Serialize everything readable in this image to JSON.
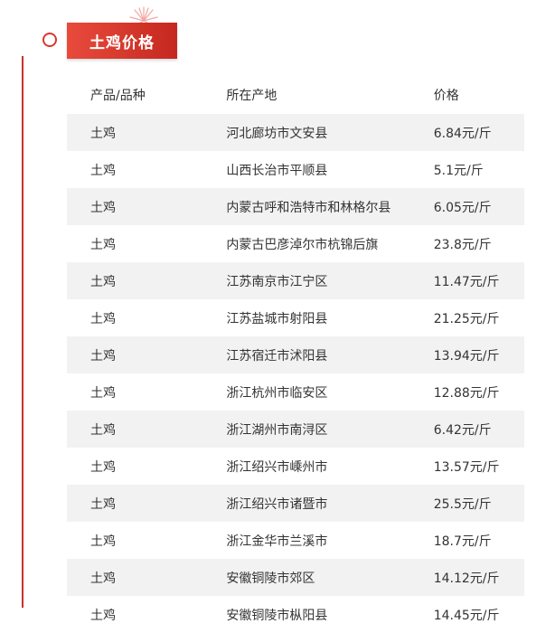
{
  "section": {
    "title": "土鸡价格"
  },
  "table": {
    "headers": [
      "产品/品种",
      "所在产地",
      "价格"
    ],
    "rows": [
      [
        "土鸡",
        "河北廊坊市文安县",
        "6.84元/斤"
      ],
      [
        "土鸡",
        "山西长治市平顺县",
        "5.1元/斤"
      ],
      [
        "土鸡",
        "内蒙古呼和浩特市和林格尔县",
        "6.05元/斤"
      ],
      [
        "土鸡",
        "内蒙古巴彦淖尔市杭锦后旗",
        "23.8元/斤"
      ],
      [
        "土鸡",
        "江苏南京市江宁区",
        "11.47元/斤"
      ],
      [
        "土鸡",
        "江苏盐城市射阳县",
        "21.25元/斤"
      ],
      [
        "土鸡",
        "江苏宿迁市沭阳县",
        "13.94元/斤"
      ],
      [
        "土鸡",
        "浙江杭州市临安区",
        "12.88元/斤"
      ],
      [
        "土鸡",
        "浙江湖州市南浔区",
        "6.42元/斤"
      ],
      [
        "土鸡",
        "浙江绍兴市嵊州市",
        "13.57元/斤"
      ],
      [
        "土鸡",
        "浙江绍兴市诸暨市",
        "25.5元/斤"
      ],
      [
        "土鸡",
        "浙江金华市兰溪市",
        "18.7元/斤"
      ],
      [
        "土鸡",
        "安徽铜陵市郊区",
        "14.12元/斤"
      ],
      [
        "土鸡",
        "安徽铜陵市枞阳县",
        "14.45元/斤"
      ]
    ]
  },
  "colors": {
    "accent": "#d9372f",
    "row_alt": "#f2f2f2"
  },
  "icons": {
    "marker": "circle-marker-icon",
    "decoration": "firework-icon"
  }
}
